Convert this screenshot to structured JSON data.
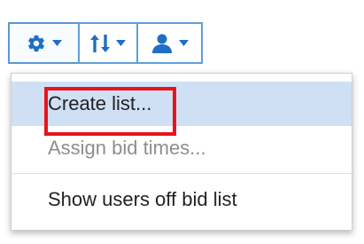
{
  "toolbar": {
    "buttons": [
      {
        "icon": "gear-icon"
      },
      {
        "icon": "sort-icon"
      },
      {
        "icon": "user-icon"
      }
    ],
    "icon_color": "#1f6fc4"
  },
  "menu": {
    "items": [
      {
        "label": "Create list...",
        "state": "hovered"
      },
      {
        "label": "Assign bid times...",
        "state": "disabled"
      },
      {
        "label": "Show users off bid list",
        "state": "enabled"
      }
    ]
  },
  "annotation": {
    "highlight_color": "#e8141c"
  }
}
